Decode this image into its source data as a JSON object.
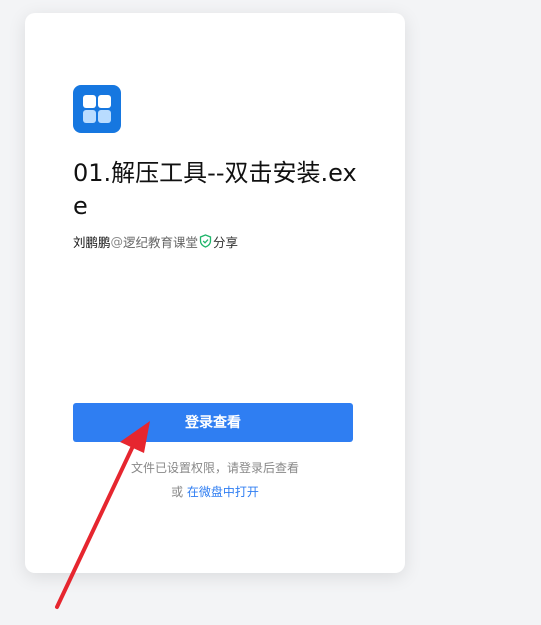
{
  "file": {
    "title": "01.解压工具--双击安装.exe"
  },
  "sharer": {
    "name": "刘鹏鹏",
    "separator": "@",
    "org": "逻纪教育课堂",
    "action": "分享"
  },
  "actions": {
    "login_label": "登录查看",
    "permission_hint": "文件已设置权限，请登录后查看",
    "or_text": "或",
    "open_in_app_label": "在微盘中打开"
  },
  "colors": {
    "accent": "#2f7ef2",
    "app_icon": "#1677e0",
    "annotation_arrow": "#e6262f"
  },
  "icons": {
    "app": "windows-grid-icon",
    "verified": "shield-check-icon"
  }
}
